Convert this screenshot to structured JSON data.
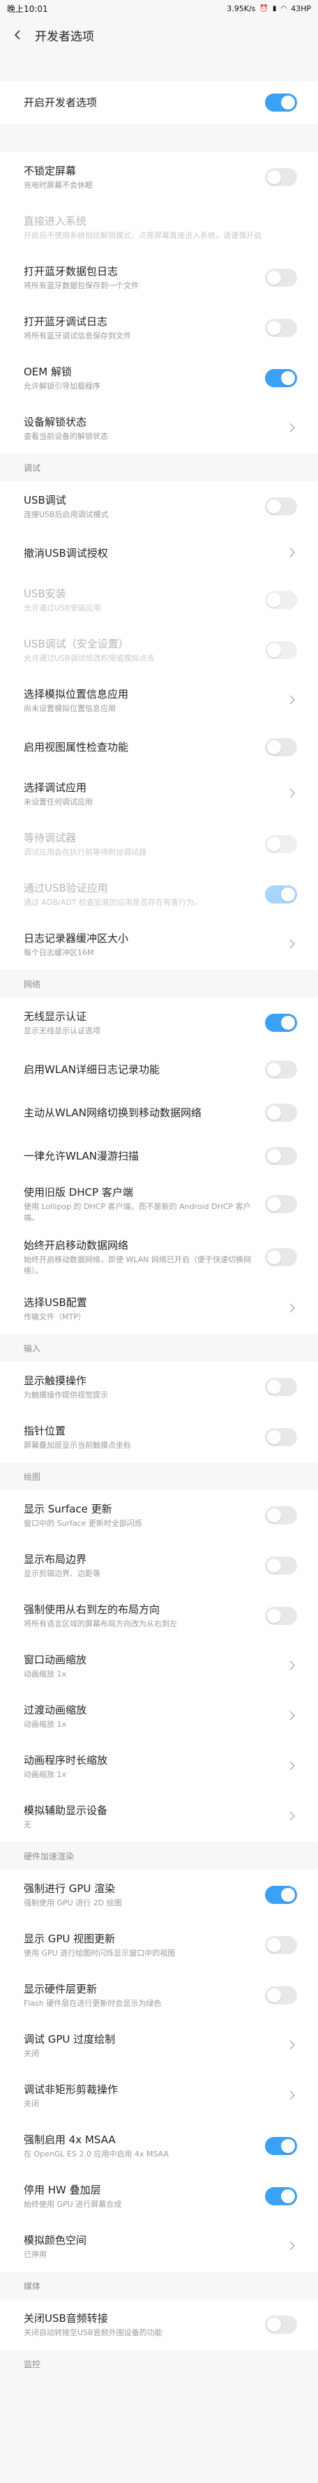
{
  "status": {
    "time": "晚上10:01",
    "speed": "3.95K/s",
    "battery": "43HP"
  },
  "header": {
    "title": "开发者选项"
  },
  "groups": [
    {
      "header": "",
      "items": [
        {
          "title": "开启开发者选项",
          "subtitle": "",
          "control": "toggle",
          "on": true,
          "disabled": false
        }
      ]
    },
    {
      "header": "",
      "items": [
        {
          "title": "不锁定屏幕",
          "subtitle": "充电时屏幕不会休眠",
          "control": "toggle",
          "on": false,
          "disabled": false
        },
        {
          "title": "直接进入系统",
          "subtitle": "开启后不使用系统指纹解锁模式，点亮屏幕直接进入系统，请谨慎开启",
          "control": "none",
          "on": false,
          "disabled": true
        },
        {
          "title": "打开蓝牙数据包日志",
          "subtitle": "将所有蓝牙数据包保存到一个文件",
          "control": "toggle",
          "on": false,
          "disabled": false
        },
        {
          "title": "打开蓝牙调试日志",
          "subtitle": "将所有蓝牙调试信息保存到文件",
          "control": "toggle",
          "on": false,
          "disabled": false
        },
        {
          "title": "OEM 解锁",
          "subtitle": "允许解锁引导加载程序",
          "control": "toggle",
          "on": true,
          "disabled": false
        },
        {
          "title": "设备解锁状态",
          "subtitle": "查看当前设备的解锁状态",
          "control": "chevron",
          "on": false,
          "disabled": false
        }
      ]
    },
    {
      "header": "调试",
      "items": [
        {
          "title": "USB调试",
          "subtitle": "连接USB后启用调试模式",
          "control": "toggle",
          "on": false,
          "disabled": false
        },
        {
          "title": "撤消USB调试授权",
          "subtitle": "",
          "control": "chevron",
          "on": false,
          "disabled": false
        },
        {
          "title": "USB安装",
          "subtitle": "允许通过USB安装应用",
          "control": "toggle",
          "on": false,
          "disabled": true
        },
        {
          "title": "USB调试（安全设置）",
          "subtitle": "允许通过USB调试修改权限或模拟点击",
          "control": "toggle",
          "on": false,
          "disabled": true
        },
        {
          "title": "选择模拟位置信息应用",
          "subtitle": "尚未设置模拟位置信息应用",
          "control": "chevron",
          "on": false,
          "disabled": false
        },
        {
          "title": "启用视图属性检查功能",
          "subtitle": "",
          "control": "toggle",
          "on": false,
          "disabled": false
        },
        {
          "title": "选择调试应用",
          "subtitle": "未设置任何调试应用",
          "control": "chevron",
          "on": false,
          "disabled": false
        },
        {
          "title": "等待调试器",
          "subtitle": "调试应用会在执行前等待附加调试器",
          "control": "toggle",
          "on": false,
          "disabled": true
        },
        {
          "title": "通过USB验证应用",
          "subtitle": "通过 ADB/ADT 检查安装的应用是否存在有害行为。",
          "control": "toggle",
          "on": true,
          "disabled": true
        },
        {
          "title": "日志记录器缓冲区大小",
          "subtitle": "每个日志缓冲区16M",
          "control": "chevron",
          "on": false,
          "disabled": false
        }
      ]
    },
    {
      "header": "网络",
      "items": [
        {
          "title": "无线显示认证",
          "subtitle": "显示无线显示认证选项",
          "control": "toggle",
          "on": true,
          "disabled": false
        },
        {
          "title": "启用WLAN详细日志记录功能",
          "subtitle": "",
          "control": "toggle",
          "on": false,
          "disabled": false
        },
        {
          "title": "主动从WLAN网络切换到移动数据网络",
          "subtitle": "",
          "control": "toggle",
          "on": false,
          "disabled": false
        },
        {
          "title": "一律允许WLAN漫游扫描",
          "subtitle": "",
          "control": "toggle",
          "on": false,
          "disabled": false
        },
        {
          "title": "使用旧版 DHCP 客户端",
          "subtitle": "使用 Lollipop 的 DHCP 客户端，而不是新的 Android DHCP 客户端。",
          "control": "toggle",
          "on": false,
          "disabled": false
        },
        {
          "title": "始终开启移动数据网络",
          "subtitle": "始终开启移动数据网络，即使 WLAN 网络已开启（便于快速切换网络）。",
          "control": "toggle",
          "on": false,
          "disabled": false
        },
        {
          "title": "选择USB配置",
          "subtitle": "传输文件（MTP）",
          "control": "chevron",
          "on": false,
          "disabled": false
        }
      ]
    },
    {
      "header": "输入",
      "items": [
        {
          "title": "显示触摸操作",
          "subtitle": "为触摸操作提供视觉提示",
          "control": "toggle",
          "on": false,
          "disabled": false
        },
        {
          "title": "指针位置",
          "subtitle": "屏幕叠加层显示当前触摸点坐标",
          "control": "toggle",
          "on": false,
          "disabled": false
        }
      ]
    },
    {
      "header": "绘图",
      "items": [
        {
          "title": "显示 Surface 更新",
          "subtitle": "窗口中的 Surface 更新时全部闪烁",
          "control": "toggle",
          "on": false,
          "disabled": false
        },
        {
          "title": "显示布局边界",
          "subtitle": "显示剪辑边界、边距等",
          "control": "toggle",
          "on": false,
          "disabled": false
        },
        {
          "title": "强制使用从右到左的布局方向",
          "subtitle": "将所有语言区域的屏幕布局方向改为从右到左",
          "control": "toggle",
          "on": false,
          "disabled": false
        },
        {
          "title": "窗口动画缩放",
          "subtitle": "动画缩放 1x",
          "control": "chevron",
          "on": false,
          "disabled": false
        },
        {
          "title": "过渡动画缩放",
          "subtitle": "动画缩放 1x",
          "control": "chevron",
          "on": false,
          "disabled": false
        },
        {
          "title": "动画程序时长缩放",
          "subtitle": "动画缩放 1x",
          "control": "chevron",
          "on": false,
          "disabled": false
        },
        {
          "title": "模拟辅助显示设备",
          "subtitle": "无",
          "control": "chevron",
          "on": false,
          "disabled": false
        }
      ]
    },
    {
      "header": "硬件加速渲染",
      "items": [
        {
          "title": "强制进行 GPU 渲染",
          "subtitle": "强制使用 GPU 进行 2D 绘图",
          "control": "toggle",
          "on": true,
          "disabled": false
        },
        {
          "title": "显示 GPU 视图更新",
          "subtitle": "使用 GPU 进行绘图时闪烁显示窗口中的视图",
          "control": "toggle",
          "on": false,
          "disabled": false
        },
        {
          "title": "显示硬件层更新",
          "subtitle": "Flash 硬件层在进行更新时会显示为绿色",
          "control": "toggle",
          "on": false,
          "disabled": false
        },
        {
          "title": "调试 GPU 过度绘制",
          "subtitle": "关闭",
          "control": "chevron",
          "on": false,
          "disabled": false
        },
        {
          "title": "调试非矩形剪裁操作",
          "subtitle": "关闭",
          "control": "chevron",
          "on": false,
          "disabled": false
        },
        {
          "title": "强制启用 4x MSAA",
          "subtitle": "在 OpenGL ES 2.0 应用中启用 4x MSAA",
          "control": "toggle",
          "on": true,
          "disabled": false
        },
        {
          "title": "停用 HW 叠加层",
          "subtitle": "始终使用 GPU 进行屏幕合成",
          "control": "toggle",
          "on": true,
          "disabled": false
        },
        {
          "title": "模拟颜色空间",
          "subtitle": "已停用",
          "control": "chevron",
          "on": false,
          "disabled": false
        }
      ]
    },
    {
      "header": "媒体",
      "items": [
        {
          "title": "关闭USB音频转接",
          "subtitle": "关闭自动转接至USB音频外围设备的功能",
          "control": "toggle",
          "on": false,
          "disabled": false
        }
      ]
    },
    {
      "header": "监控",
      "items": []
    }
  ]
}
